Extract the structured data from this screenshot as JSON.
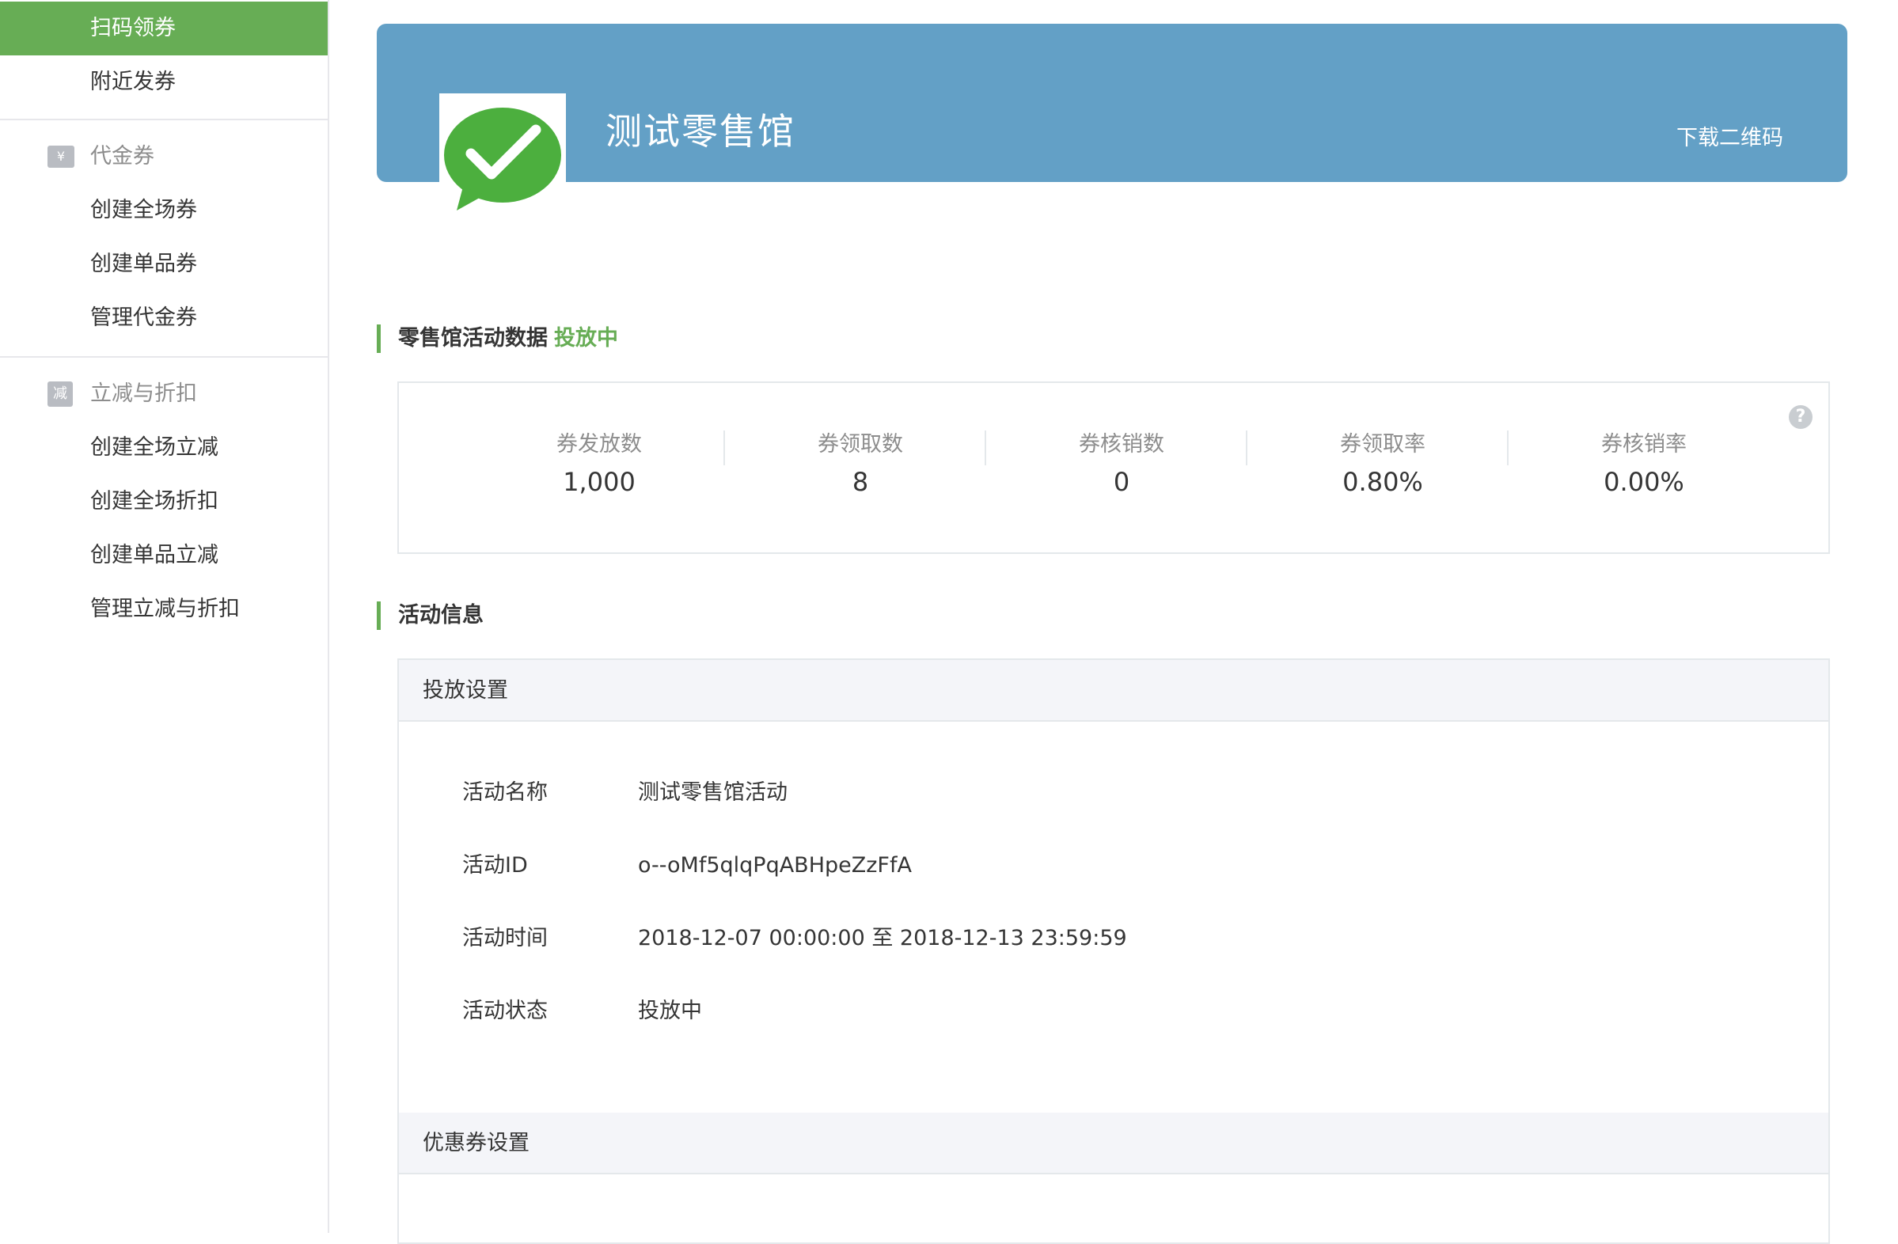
{
  "sidebar": {
    "top_items": [
      "扫码领券",
      "附近发券"
    ],
    "voucher_group": {
      "label": "代金券",
      "icon_text": "¥",
      "items": [
        "创建全场券",
        "创建单品券",
        "管理代金券"
      ]
    },
    "discount_group": {
      "label": "立减与折扣",
      "icon_text": "减",
      "items": [
        "创建全场立减",
        "创建全场折扣",
        "创建单品立减",
        "管理立减与折扣"
      ]
    }
  },
  "header": {
    "title": "测试零售馆",
    "download_link": "下载二维码"
  },
  "stats_section": {
    "title": "零售馆活动数据",
    "status": "投放中",
    "help_icon": "?",
    "items": [
      {
        "label": "券发放数",
        "value": "1,000"
      },
      {
        "label": "券领取数",
        "value": "8"
      },
      {
        "label": "券核销数",
        "value": "0"
      },
      {
        "label": "券领取率",
        "value": "0.80%"
      },
      {
        "label": "券核销率",
        "value": "0.00%"
      }
    ]
  },
  "info_section": {
    "title": "活动信息",
    "delivery_settings": {
      "heading": "投放设置",
      "rows": [
        {
          "label": "活动名称",
          "value": "测试零售馆活动"
        },
        {
          "label": "活动ID",
          "value": "o--oMf5qlqPqABHpeZzFfA"
        },
        {
          "label": "活动时间",
          "value": "2018-12-07 00:00:00 至 2018-12-13 23:59:59"
        },
        {
          "label": "活动状态",
          "value": "投放中"
        }
      ]
    },
    "coupon_settings": {
      "heading": "优惠券设置",
      "rows": [
        {
          "label": "",
          "value": ""
        }
      ]
    }
  },
  "colors": {
    "accent_green": "#67ad55",
    "banner_blue": "#63a0c6",
    "logo_green": "#4caf3e"
  },
  "icons": {
    "logo": "wechat-check-logo-icon",
    "voucher": "yen-icon",
    "discount": "discount-icon",
    "help": "help-circle-icon"
  }
}
